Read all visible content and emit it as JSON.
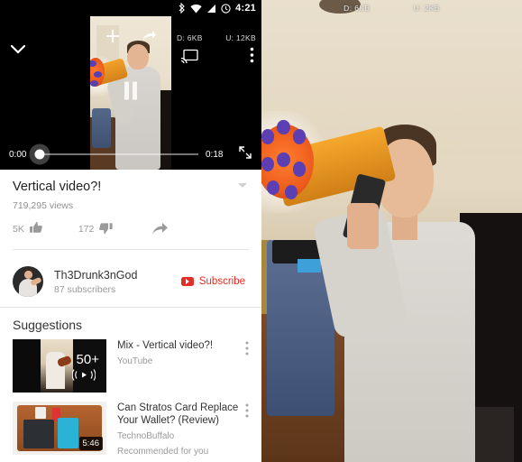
{
  "statusbar": {
    "time": "4:21",
    "icons": [
      "bluetooth-icon",
      "wifi-icon",
      "signal-icon",
      "alarm-icon"
    ]
  },
  "player": {
    "download_label": "D: 6KB",
    "upload_label": "U: 12KB",
    "current_time": "0:00",
    "duration": "0:18",
    "collapse_icon": "chevron-down-icon",
    "add_icon": "plus-icon",
    "share_icon": "share-arrow-icon",
    "cast_icon": "cast-icon",
    "overflow_icon": "kebab-menu-icon",
    "pause_icon": "pause-icon",
    "fullscreen_icon": "fullscreen-expand-icon"
  },
  "video": {
    "title": "Vertical video?!",
    "views": "719,295 views",
    "likes": "5K",
    "dislikes": "172",
    "expand_icon": "chevron-down-icon",
    "like_icon": "thumbs-up-icon",
    "dislike_icon": "thumbs-down-icon",
    "share_icon": "share-arrow-icon"
  },
  "channel": {
    "name": "Th3Drunk3nGod",
    "subscribers": "87 subscribers",
    "subscribe_label": "Subscribe",
    "subscribe_color": "#e52d27"
  },
  "suggestions": {
    "heading": "Suggestions",
    "items": [
      {
        "title": "Mix - Vertical video?!",
        "subtitle": "YouTube",
        "badge": "50+",
        "badge_icon": "mix-radio-icon",
        "duration": "",
        "extra": "",
        "menu_icon": "kebab-menu-icon"
      },
      {
        "title": "Can Stratos Card Replace Your Wallet? (Review)",
        "subtitle": "TechnoBuffalo",
        "badge": "",
        "badge_icon": "",
        "duration": "5:46",
        "extra": "Recommended for you",
        "menu_icon": "kebab-menu-icon"
      }
    ]
  },
  "fullscreen": {
    "download_label": "D: 6KB",
    "upload_label": "U: 2KB"
  }
}
